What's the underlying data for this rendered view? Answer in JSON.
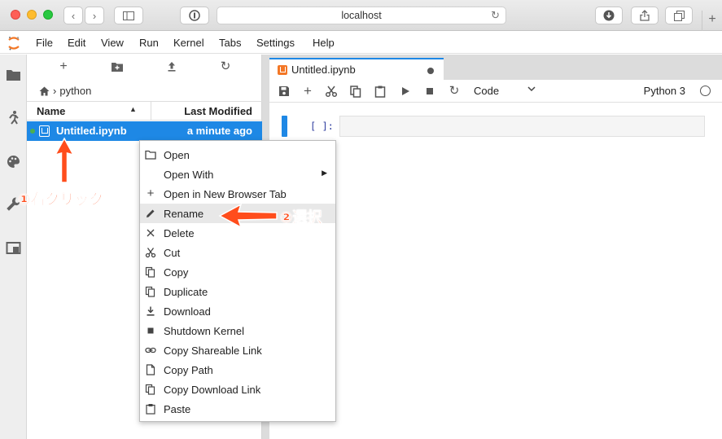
{
  "browser": {
    "url": "localhost"
  },
  "menubar": {
    "items": [
      "File",
      "Edit",
      "View",
      "Run",
      "Kernel",
      "Tabs",
      "Settings",
      "Help"
    ]
  },
  "filebrowser": {
    "breadcrumb": "python",
    "columns": {
      "name": "Name",
      "modified": "Last Modified"
    },
    "files": [
      {
        "name": "Untitled.ipynb",
        "modified": "a minute ago"
      }
    ]
  },
  "notebook": {
    "tab_label": "Untitled.ipynb",
    "cell_type": "Code",
    "kernel": "Python 3",
    "cell_prompt": "[ ]:"
  },
  "context_menu": {
    "items": [
      {
        "label": "Open",
        "icon": "folder-icon"
      },
      {
        "label": "Open With",
        "icon": "",
        "submenu": true
      },
      {
        "label": "Open in New Browser Tab",
        "icon": "plus-icon"
      },
      {
        "label": "Rename",
        "icon": "pencil-icon",
        "highlighted": true
      },
      {
        "label": "Delete",
        "icon": "close-icon"
      },
      {
        "label": "Cut",
        "icon": "scissors-icon"
      },
      {
        "label": "Copy",
        "icon": "copy-icon"
      },
      {
        "label": "Duplicate",
        "icon": "duplicate-icon"
      },
      {
        "label": "Download",
        "icon": "download-icon"
      },
      {
        "label": "Shutdown Kernel",
        "icon": "stop-icon"
      },
      {
        "label": "Copy Shareable Link",
        "icon": "link-icon"
      },
      {
        "label": "Copy Path",
        "icon": "file-icon"
      },
      {
        "label": "Copy Download Link",
        "icon": "copy-icon"
      },
      {
        "label": "Paste",
        "icon": "paste-icon"
      }
    ]
  },
  "annotations": {
    "step1": "①右クリック",
    "step2": "②選択",
    "color": "#ff4d1c"
  }
}
